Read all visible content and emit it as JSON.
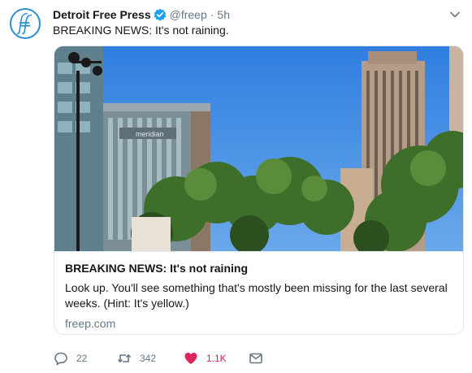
{
  "tweet": {
    "display_name": "Detroit Free Press",
    "handle": "@freep",
    "separator": "·",
    "time": "5h",
    "text": "BREAKING NEWS: It's not raining."
  },
  "card": {
    "title": "BREAKING NEWS: It's not raining",
    "description": "Look up. You'll see something that's mostly been missing for the last several weeks. (Hint: It's yellow.)",
    "domain": "freep.com",
    "sign_text": "meridian"
  },
  "actions": {
    "reply_count": "22",
    "retweet_count": "342",
    "like_count": "1.1K"
  },
  "icons": {
    "avatar": "freep-logo-icon",
    "verified": "verified-badge-icon",
    "caret": "chevron-down-icon",
    "reply": "reply-icon",
    "retweet": "retweet-icon",
    "like": "heart-icon",
    "dm": "envelope-icon"
  },
  "colors": {
    "brand_blue": "#2a8fd0",
    "verified_blue": "#1da1f2",
    "like_red": "#e0245e",
    "muted": "#657786",
    "sky": "#3d86e0"
  }
}
